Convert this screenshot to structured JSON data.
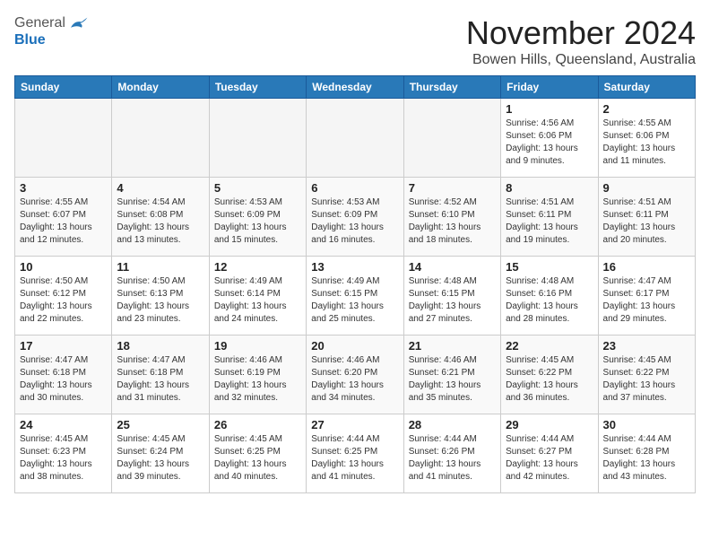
{
  "logo": {
    "general": "General",
    "blue": "Blue"
  },
  "header": {
    "month": "November 2024",
    "location": "Bowen Hills, Queensland, Australia"
  },
  "weekdays": [
    "Sunday",
    "Monday",
    "Tuesday",
    "Wednesday",
    "Thursday",
    "Friday",
    "Saturday"
  ],
  "weeks": [
    [
      {
        "day": "",
        "info": ""
      },
      {
        "day": "",
        "info": ""
      },
      {
        "day": "",
        "info": ""
      },
      {
        "day": "",
        "info": ""
      },
      {
        "day": "",
        "info": ""
      },
      {
        "day": "1",
        "info": "Sunrise: 4:56 AM\nSunset: 6:06 PM\nDaylight: 13 hours\nand 9 minutes."
      },
      {
        "day": "2",
        "info": "Sunrise: 4:55 AM\nSunset: 6:06 PM\nDaylight: 13 hours\nand 11 minutes."
      }
    ],
    [
      {
        "day": "3",
        "info": "Sunrise: 4:55 AM\nSunset: 6:07 PM\nDaylight: 13 hours\nand 12 minutes."
      },
      {
        "day": "4",
        "info": "Sunrise: 4:54 AM\nSunset: 6:08 PM\nDaylight: 13 hours\nand 13 minutes."
      },
      {
        "day": "5",
        "info": "Sunrise: 4:53 AM\nSunset: 6:09 PM\nDaylight: 13 hours\nand 15 minutes."
      },
      {
        "day": "6",
        "info": "Sunrise: 4:53 AM\nSunset: 6:09 PM\nDaylight: 13 hours\nand 16 minutes."
      },
      {
        "day": "7",
        "info": "Sunrise: 4:52 AM\nSunset: 6:10 PM\nDaylight: 13 hours\nand 18 minutes."
      },
      {
        "day": "8",
        "info": "Sunrise: 4:51 AM\nSunset: 6:11 PM\nDaylight: 13 hours\nand 19 minutes."
      },
      {
        "day": "9",
        "info": "Sunrise: 4:51 AM\nSunset: 6:11 PM\nDaylight: 13 hours\nand 20 minutes."
      }
    ],
    [
      {
        "day": "10",
        "info": "Sunrise: 4:50 AM\nSunset: 6:12 PM\nDaylight: 13 hours\nand 22 minutes."
      },
      {
        "day": "11",
        "info": "Sunrise: 4:50 AM\nSunset: 6:13 PM\nDaylight: 13 hours\nand 23 minutes."
      },
      {
        "day": "12",
        "info": "Sunrise: 4:49 AM\nSunset: 6:14 PM\nDaylight: 13 hours\nand 24 minutes."
      },
      {
        "day": "13",
        "info": "Sunrise: 4:49 AM\nSunset: 6:15 PM\nDaylight: 13 hours\nand 25 minutes."
      },
      {
        "day": "14",
        "info": "Sunrise: 4:48 AM\nSunset: 6:15 PM\nDaylight: 13 hours\nand 27 minutes."
      },
      {
        "day": "15",
        "info": "Sunrise: 4:48 AM\nSunset: 6:16 PM\nDaylight: 13 hours\nand 28 minutes."
      },
      {
        "day": "16",
        "info": "Sunrise: 4:47 AM\nSunset: 6:17 PM\nDaylight: 13 hours\nand 29 minutes."
      }
    ],
    [
      {
        "day": "17",
        "info": "Sunrise: 4:47 AM\nSunset: 6:18 PM\nDaylight: 13 hours\nand 30 minutes."
      },
      {
        "day": "18",
        "info": "Sunrise: 4:47 AM\nSunset: 6:18 PM\nDaylight: 13 hours\nand 31 minutes."
      },
      {
        "day": "19",
        "info": "Sunrise: 4:46 AM\nSunset: 6:19 PM\nDaylight: 13 hours\nand 32 minutes."
      },
      {
        "day": "20",
        "info": "Sunrise: 4:46 AM\nSunset: 6:20 PM\nDaylight: 13 hours\nand 34 minutes."
      },
      {
        "day": "21",
        "info": "Sunrise: 4:46 AM\nSunset: 6:21 PM\nDaylight: 13 hours\nand 35 minutes."
      },
      {
        "day": "22",
        "info": "Sunrise: 4:45 AM\nSunset: 6:22 PM\nDaylight: 13 hours\nand 36 minutes."
      },
      {
        "day": "23",
        "info": "Sunrise: 4:45 AM\nSunset: 6:22 PM\nDaylight: 13 hours\nand 37 minutes."
      }
    ],
    [
      {
        "day": "24",
        "info": "Sunrise: 4:45 AM\nSunset: 6:23 PM\nDaylight: 13 hours\nand 38 minutes."
      },
      {
        "day": "25",
        "info": "Sunrise: 4:45 AM\nSunset: 6:24 PM\nDaylight: 13 hours\nand 39 minutes."
      },
      {
        "day": "26",
        "info": "Sunrise: 4:45 AM\nSunset: 6:25 PM\nDaylight: 13 hours\nand 40 minutes."
      },
      {
        "day": "27",
        "info": "Sunrise: 4:44 AM\nSunset: 6:25 PM\nDaylight: 13 hours\nand 41 minutes."
      },
      {
        "day": "28",
        "info": "Sunrise: 4:44 AM\nSunset: 6:26 PM\nDaylight: 13 hours\nand 41 minutes."
      },
      {
        "day": "29",
        "info": "Sunrise: 4:44 AM\nSunset: 6:27 PM\nDaylight: 13 hours\nand 42 minutes."
      },
      {
        "day": "30",
        "info": "Sunrise: 4:44 AM\nSunset: 6:28 PM\nDaylight: 13 hours\nand 43 minutes."
      }
    ]
  ]
}
